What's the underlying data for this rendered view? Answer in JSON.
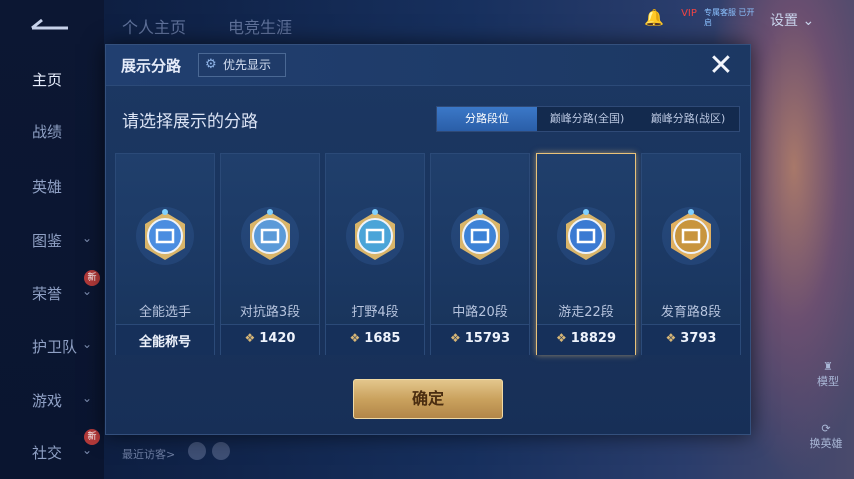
{
  "top_tabs": [
    "个人主页",
    "电竞生涯"
  ],
  "top_right": {
    "vip_label": "VIP",
    "vip_text": "专属客服 已开启",
    "settings_label": "设置"
  },
  "sidebar": {
    "items": [
      {
        "label": "主页",
        "chevron": false,
        "active": true
      },
      {
        "label": "战绩",
        "chevron": false
      },
      {
        "label": "英雄",
        "chevron": false
      },
      {
        "label": "图鉴",
        "chevron": true
      },
      {
        "label": "荣誉",
        "chevron": true,
        "badge": "新"
      },
      {
        "label": "护卫队",
        "chevron": true
      },
      {
        "label": "游戏",
        "chevron": true
      },
      {
        "label": "社交",
        "chevron": true,
        "badge": "新"
      }
    ]
  },
  "bottom": {
    "recent_visitors": "最近访客>",
    "model_label": "模型",
    "swap_label": "换英雄"
  },
  "dialog": {
    "title": "展示分路",
    "priority_button": "优先显示",
    "prompt": "请选择展示的分路",
    "tabs": [
      {
        "label": "分路段位",
        "active": true
      },
      {
        "label": "巅峰分路(全国)",
        "active": false
      },
      {
        "label": "巅峰分路(战区)",
        "active": false
      }
    ],
    "cards": [
      {
        "name": "全能选手",
        "stat": "全能称号",
        "selected": false,
        "icon": "allround-emblem-icon",
        "color": "#4b8de0"
      },
      {
        "name": "对抗路3段",
        "stat": "1420",
        "selected": false,
        "icon": "clash-lane-emblem-icon",
        "color": "#5b9ad8"
      },
      {
        "name": "打野4段",
        "stat": "1685",
        "selected": false,
        "icon": "jungle-emblem-icon",
        "color": "#4aa4d8"
      },
      {
        "name": "中路20段",
        "stat": "15793",
        "selected": false,
        "icon": "mid-lane-emblem-icon",
        "color": "#3d82d6"
      },
      {
        "name": "游走22段",
        "stat": "18829",
        "selected": true,
        "icon": "roam-emblem-icon",
        "color": "#3b7ad2"
      },
      {
        "name": "发育路8段",
        "stat": "3793",
        "selected": false,
        "icon": "farm-lane-emblem-icon",
        "color": "#c8953e"
      }
    ],
    "confirm_label": "确定"
  }
}
